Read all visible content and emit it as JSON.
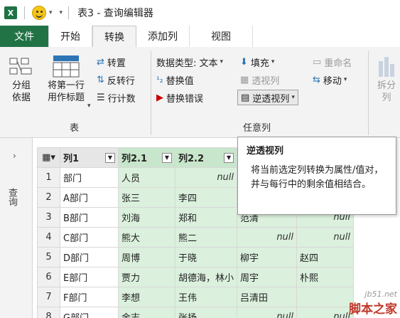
{
  "titlebar": {
    "app_icon": "X",
    "title": "表3 - 查询编辑器"
  },
  "tabs": [
    {
      "label": "文件"
    },
    {
      "label": "开始"
    },
    {
      "label": "转换"
    },
    {
      "label": "添加列"
    },
    {
      "label": "视图"
    }
  ],
  "ribbon": {
    "table_group": {
      "label": "表",
      "group_by": "分组\n依据",
      "use_first_row": "将第一行\n用作标题",
      "transpose": "转置",
      "reverse_rows": "反转行",
      "count_rows": "行计数"
    },
    "anycol_group": {
      "label": "任意列",
      "data_type": "数据类型: 文本",
      "replace_values": "替换值",
      "replace_errors": "替换错误",
      "fill": "填充",
      "pivot_column": "透视列",
      "unpivot_columns": "逆透视列",
      "rename": "重命名",
      "move": "移动"
    },
    "text_group": {
      "split_col": "拆分\n列"
    }
  },
  "query_pane": {
    "label": "查询"
  },
  "grid": {
    "headers": [
      "列1",
      "列2.1",
      "列2.2"
    ],
    "rows": [
      {
        "n": "1",
        "c1": "部门",
        "c2": "人员",
        "c3": "null",
        "c4": "",
        "c5": ""
      },
      {
        "n": "2",
        "c1": "A部门",
        "c2": "张三",
        "c3": "李四",
        "c4": "",
        "c5": ""
      },
      {
        "n": "3",
        "c1": "B部门",
        "c2": "刘海",
        "c3": "郑和",
        "c4": "范清",
        "c5": "null"
      },
      {
        "n": "4",
        "c1": "C部门",
        "c2": "熊大",
        "c3": "熊二",
        "c4": "null",
        "c5": "null"
      },
      {
        "n": "5",
        "c1": "D部门",
        "c2": "周博",
        "c3": "于晓",
        "c4": "柳宇",
        "c5": "赵四"
      },
      {
        "n": "6",
        "c1": "E部门",
        "c2": "贾力",
        "c3": "胡德海，林小",
        "c4": "周宇",
        "c5": "朴熙"
      },
      {
        "n": "7",
        "c1": "F部门",
        "c2": "李想",
        "c3": "王伟",
        "c4": "吕清田",
        "c5": ""
      },
      {
        "n": "8",
        "c1": "G部门",
        "c2": "金志",
        "c3": "张扬",
        "c4": "null",
        "c5": "null"
      }
    ]
  },
  "tooltip": {
    "title": "逆透视列",
    "body": "将当前选定列转换为属性/值对，并与每行中的剩余值相结合。"
  },
  "watermark": {
    "line1": "jb51.net",
    "line2": "脚本之家"
  }
}
